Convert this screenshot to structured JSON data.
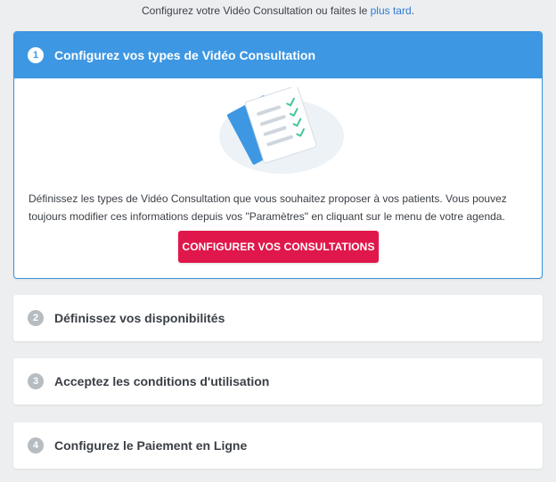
{
  "intro": {
    "text": "Configurez votre Vidéo Consultation ou faites le ",
    "link": "plus tard",
    "suffix": "."
  },
  "steps": [
    {
      "number": "1",
      "title": "Configurez vos types de Vidéo Consultation",
      "description": "Définissez les types de Vidéo Consultation que vous souhaitez proposer à vos patients. Vous pouvez toujours modifier ces informations depuis vos \"Paramètres\" en cliquant sur le menu de votre agenda.",
      "button_label": "CONFIGURER VOS CONSULTATIONS",
      "illustration_icon": "document-checklist-icon"
    },
    {
      "number": "2",
      "title": "Définissez vos disponibilités"
    },
    {
      "number": "3",
      "title": "Acceptez les conditions d'utilisation"
    },
    {
      "number": "4",
      "title": "Configurez le Paiement en Ligne"
    }
  ],
  "colors": {
    "background": "#eceef0",
    "active_header": "#3d97e3",
    "primary_button": "#e0174a",
    "link": "#2f7bd4",
    "inactive_step_number": "#b7bcc1",
    "check_marks": "#42c49a"
  }
}
